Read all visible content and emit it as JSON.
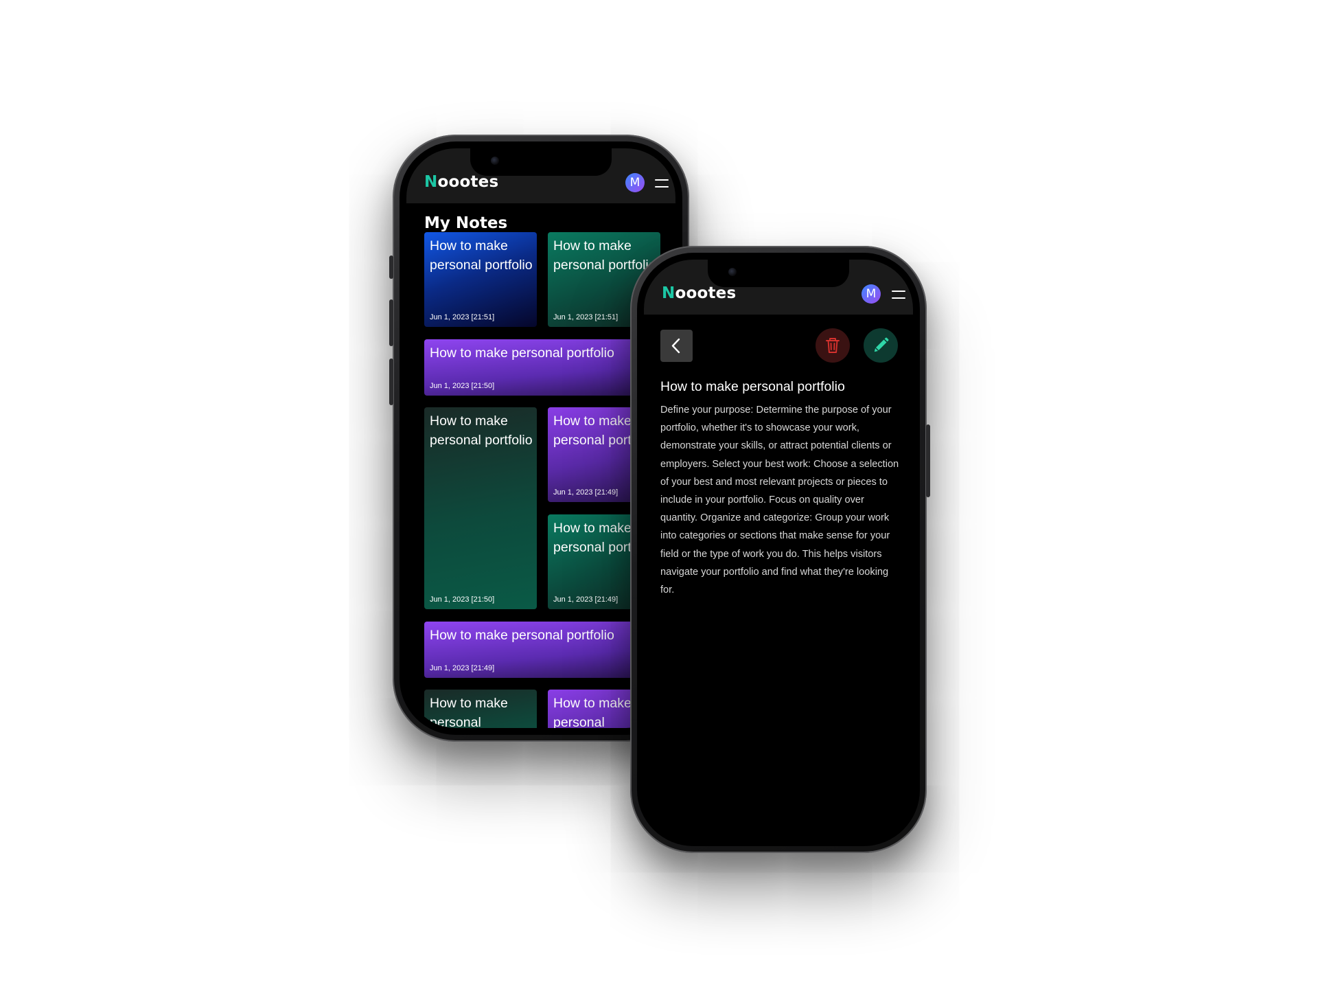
{
  "app": {
    "logo_initial": "N",
    "logo_rest": "oootes",
    "avatar_letter": "M",
    "brand_color": "#1cc7a5"
  },
  "notes_screen": {
    "title": "My Notes",
    "notes": [
      {
        "title": "How to make personal portfolio",
        "date": "Jun 1, 2023 [21:51]",
        "style": "blue"
      },
      {
        "title": "How to make personal portfolio",
        "date": "Jun 1, 2023 [21:51]",
        "style": "green"
      },
      {
        "title": "How to make personal portfolio",
        "date": "Jun 1, 2023 [21:50]",
        "style": "purple"
      },
      {
        "title": "How to make personal portfolio",
        "date": "Jun 1, 2023 [21:50]",
        "style": "green-dark"
      },
      {
        "title": "How to make personal portfolio",
        "date": "Jun 1, 2023 [21:49]",
        "style": "purple"
      },
      {
        "title": "How to make personal portfolio",
        "date": "Jun 1, 2023 [21:49]",
        "style": "green"
      },
      {
        "title": "How to make personal portfolio",
        "date": "Jun 1, 2023 [21:49]",
        "style": "purple"
      },
      {
        "title": "How to make personal",
        "date": "",
        "style": "green-dark"
      },
      {
        "title": "How to make personal",
        "date": "",
        "style": "purple"
      }
    ]
  },
  "detail_screen": {
    "icons": {
      "back": "chevron-left-icon",
      "delete": "trash-icon",
      "edit": "pencil-icon"
    },
    "delete_color": "#d6322e",
    "edit_color": "#2fd6a8",
    "title": "How to make personal portfolio",
    "body": "Define your purpose: Determine the purpose of your portfolio, whether it's to showcase your work, demonstrate your skills, or attract potential clients or employers. Select your best work: Choose a selection of your best and most relevant projects or pieces to include in your portfolio. Focus on quality over quantity. Organize and categorize: Group your work into categories or sections that make sense for your field or the type of work you do. This helps visitors navigate your portfolio and find what they're looking for."
  }
}
